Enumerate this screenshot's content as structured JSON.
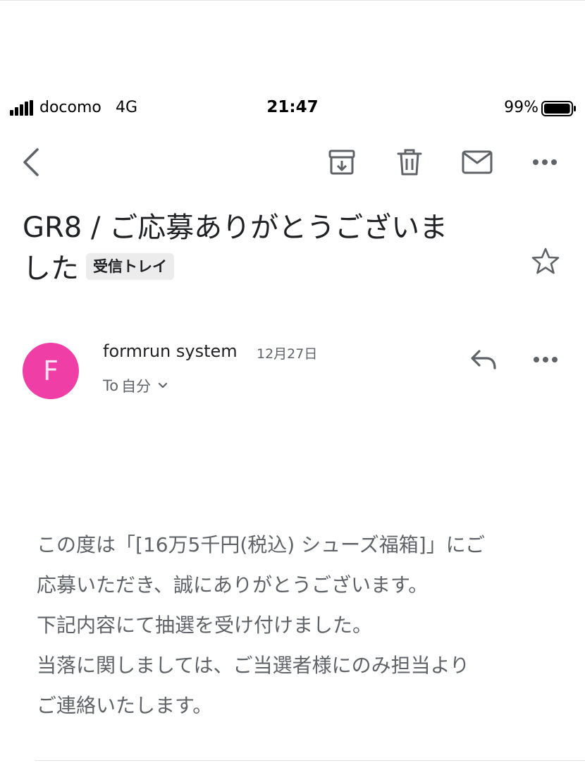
{
  "status_bar": {
    "carrier": "docomo",
    "network": "4G",
    "time": "21:47",
    "battery": "99%",
    "battery_level": 0.99
  },
  "toolbar": {
    "back_icon": "chevron-left-icon",
    "archive_icon": "archive-icon",
    "delete_icon": "trash-icon",
    "mark_unread_icon": "envelope-icon",
    "more_icon": "more-horizontal-icon"
  },
  "email": {
    "subject_line1": "GR8 / ご応募ありがとうございま",
    "subject_line2": "した",
    "label": "受信トレイ",
    "sender": {
      "initial": "F",
      "name": "formrun system",
      "date": "12月27日",
      "recipient_prefix": "To",
      "recipient": "自分"
    },
    "body_lines": [
      "この度は「[16万5千円(税込) シューズ福箱]」にご",
      "応募いただき、誠にありがとうございます。",
      "下記内容にて抽選を受け付けました。",
      "当落に関しましては、ご当選者様にのみ担当より",
      "ご連絡いたします。"
    ]
  },
  "colors": {
    "avatar_bg": "#ef3fa6",
    "icon_gray": "#5f6368",
    "text": "#202124",
    "chip_bg": "#ececec"
  }
}
